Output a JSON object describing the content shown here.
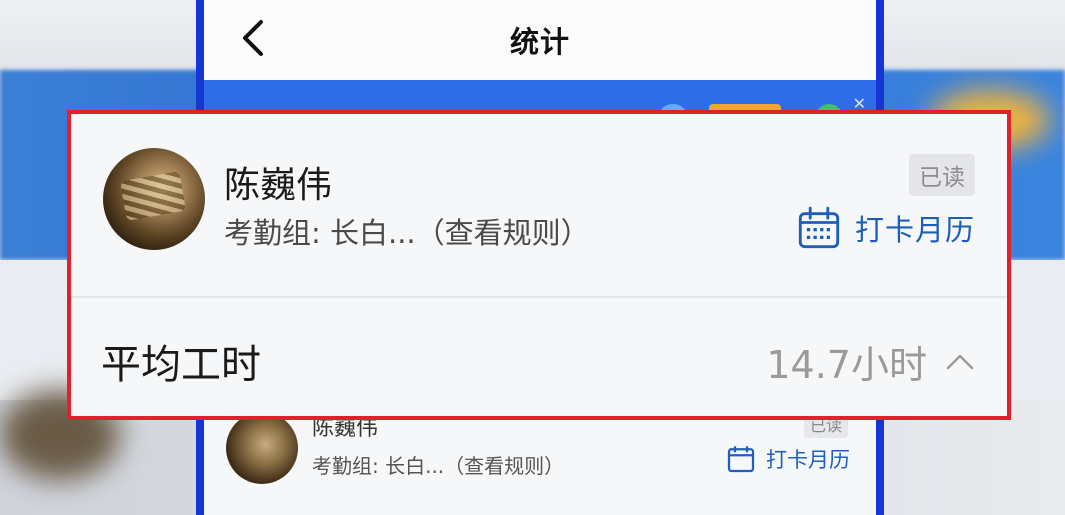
{
  "nav": {
    "title": "统计"
  },
  "card": {
    "user_name": "陈巍伟",
    "group_label": "考勤组: 长白...",
    "rules_link": "（查看规则）",
    "read_status": "已读",
    "calendar_label": "打卡月历"
  },
  "metric": {
    "label": "平均工时",
    "value": "14.7小时"
  },
  "colors": {
    "frame_blue": "#1535d4",
    "highlight_red": "#e0202a",
    "link_blue": "#1d5fb8"
  },
  "icons": {
    "back": "chevron-left-icon",
    "calendar": "calendar-icon",
    "collapse": "chevron-up-icon"
  }
}
